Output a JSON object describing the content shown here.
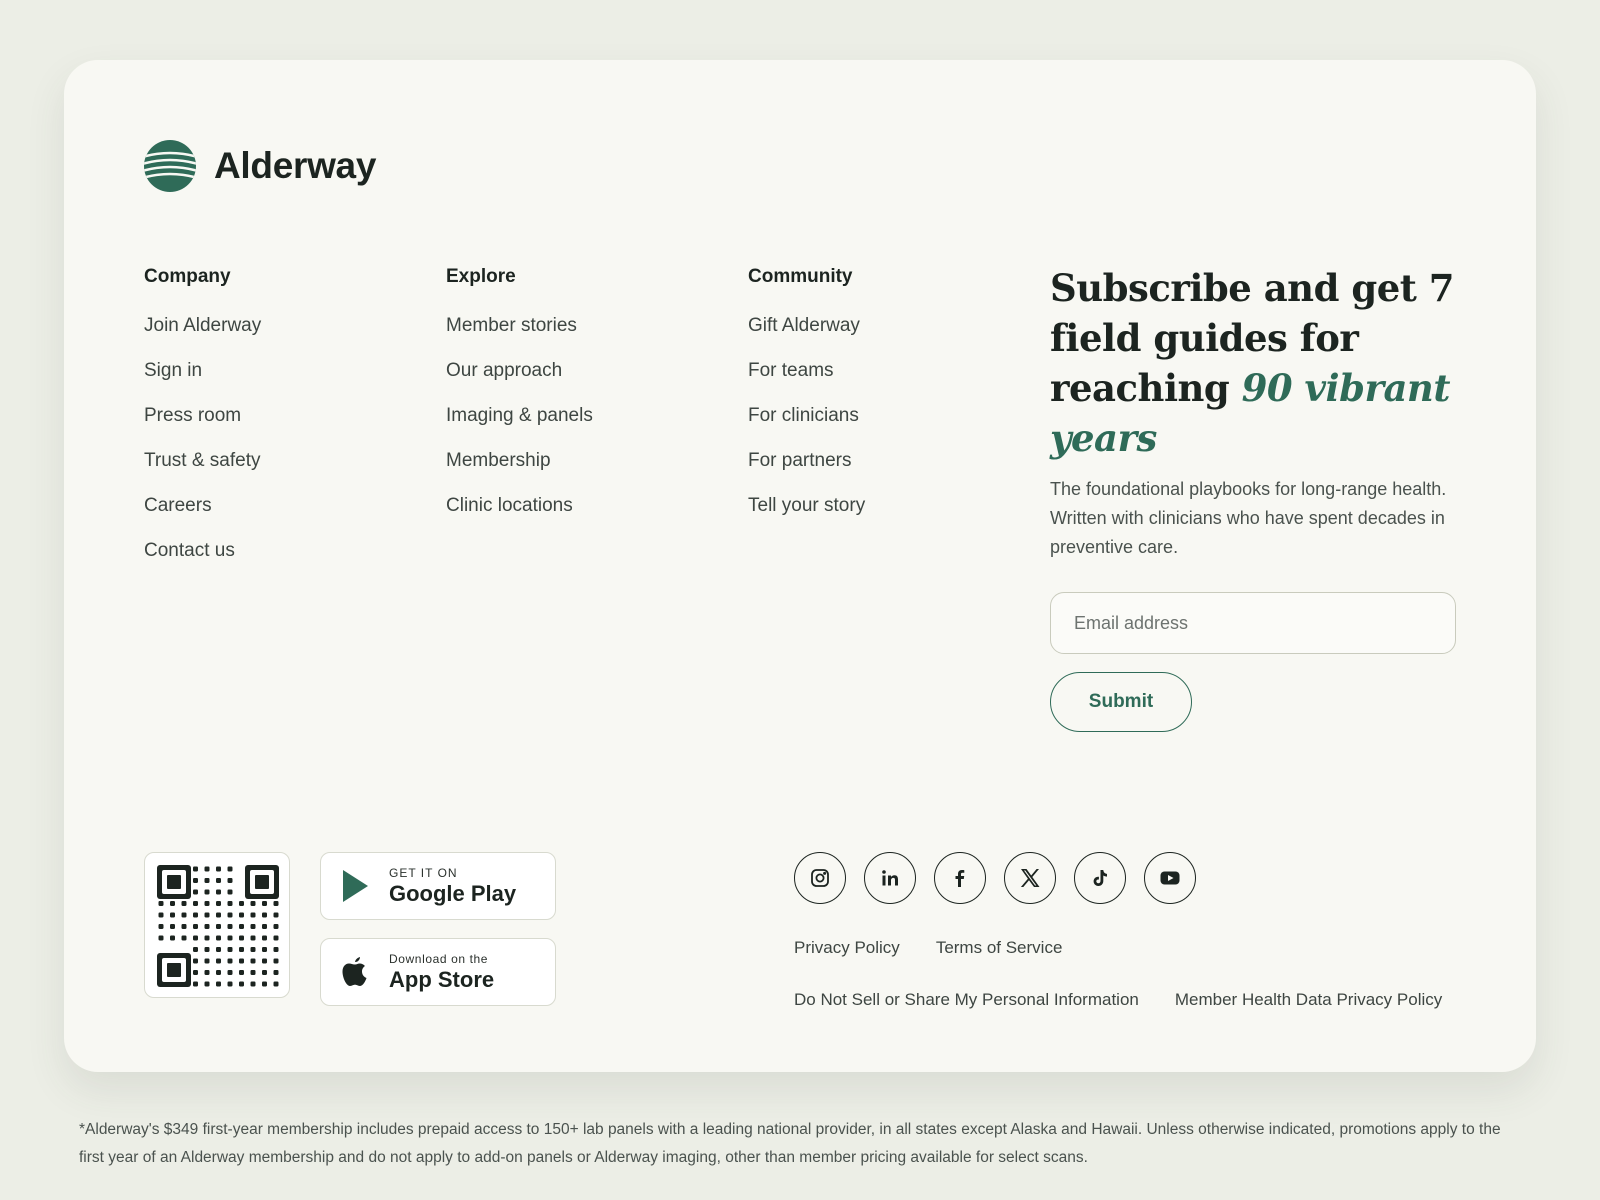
{
  "brand": {
    "name": "Alderway",
    "logo_icon": "striped-circle-logo-icon",
    "accent": "#2f6b58"
  },
  "columns": [
    {
      "heading": "Company",
      "links": [
        "Join Alderway",
        "Sign in",
        "Press room",
        "Trust & safety",
        "Careers",
        "Contact us"
      ]
    },
    {
      "heading": "Explore",
      "links": [
        "Member stories",
        "Our approach",
        "Imaging & panels",
        "Membership",
        "Clinic locations"
      ]
    },
    {
      "heading": "Community",
      "links": [
        "Gift Alderway",
        "For teams",
        "For clinicians",
        "For partners",
        "Tell your story"
      ]
    }
  ],
  "subscribe": {
    "title_plain": "Subscribe and get 7 field guides for reaching ",
    "title_accent": "90 vibrant years",
    "description": "The foundational playbooks for long-range health. Written with clinicians who have spent decades in preventive care.",
    "email_placeholder": "Email address",
    "email_value": "",
    "submit_label": "Submit"
  },
  "apps": {
    "qr_icon": "qr-code-icon",
    "google_play": {
      "small": "GET IT ON",
      "big": "Google Play",
      "icon": "play-triangle-icon"
    },
    "app_store": {
      "small": "Download on the",
      "big": "App Store",
      "icon": "apple-icon"
    }
  },
  "social": [
    {
      "name": "instagram",
      "icon": "instagram-icon"
    },
    {
      "name": "linkedin",
      "icon": "linkedin-icon"
    },
    {
      "name": "facebook",
      "icon": "facebook-icon"
    },
    {
      "name": "x",
      "icon": "x-icon"
    },
    {
      "name": "tiktok",
      "icon": "tiktok-icon"
    },
    {
      "name": "youtube",
      "icon": "youtube-icon"
    }
  ],
  "legal": {
    "privacy": "Privacy Policy",
    "terms": "Terms of Service",
    "do_not_sell": "Do Not Sell or Share My Personal Information",
    "health_privacy": "Member Health Data Privacy Policy"
  },
  "disclaimer": "*Alderway's $349 first-year membership includes prepaid access to 150+ lab panels with a leading national provider, in all states except Alaska and Hawaii. Unless otherwise indicated, promotions apply to the first year of an Alderway membership and do not apply to add-on panels or Alderway imaging, other than member pricing available for select scans."
}
